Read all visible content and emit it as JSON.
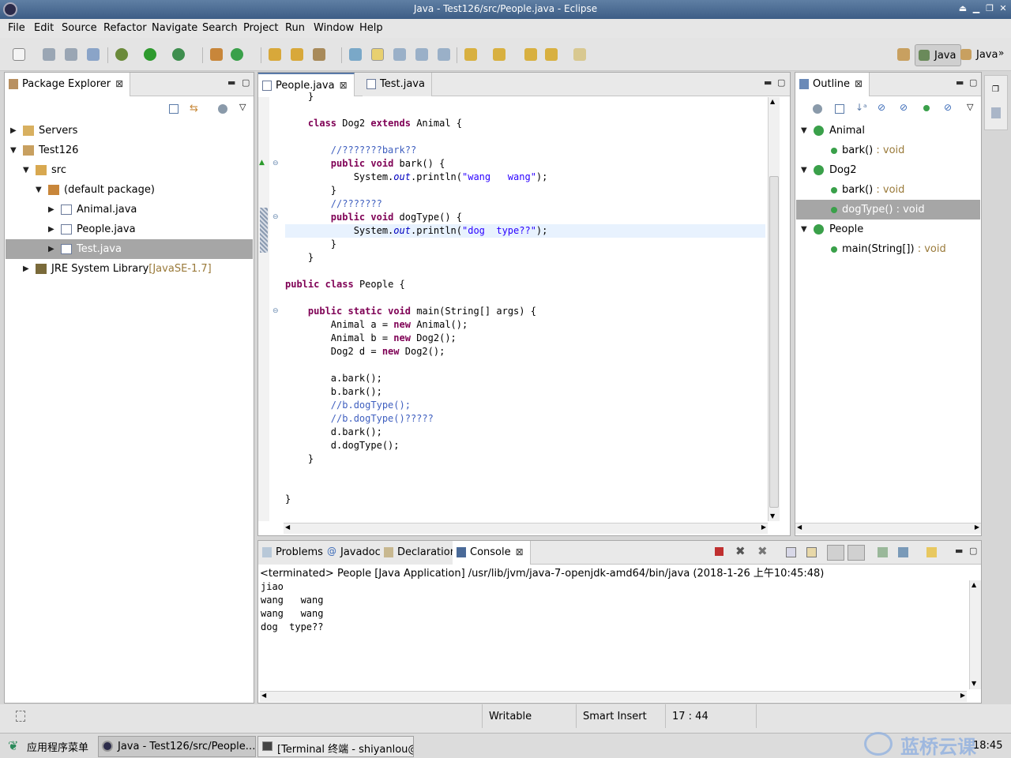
{
  "window": {
    "title": "Java - Test126/src/People.java - Eclipse"
  },
  "menubar": [
    "File",
    "Edit",
    "Source",
    "Refactor",
    "Navigate",
    "Search",
    "Project",
    "Run",
    "Window",
    "Help"
  ],
  "perspectives": [
    "Java",
    "Java"
  ],
  "package_explorer": {
    "title": "Package Explorer",
    "tree": [
      {
        "label": "Servers",
        "indent": 0,
        "expanded": false,
        "icon": "folder-icon"
      },
      {
        "label": "Test126",
        "indent": 0,
        "expanded": true,
        "icon": "project-icon"
      },
      {
        "label": "src",
        "indent": 1,
        "expanded": true,
        "icon": "source-folder-icon"
      },
      {
        "label": "(default package)",
        "indent": 2,
        "expanded": true,
        "icon": "package-icon"
      },
      {
        "label": "Animal.java",
        "indent": 3,
        "expanded": false,
        "icon": "java-file-icon"
      },
      {
        "label": "People.java",
        "indent": 3,
        "expanded": false,
        "icon": "java-file-icon"
      },
      {
        "label": "Test.java",
        "indent": 3,
        "expanded": false,
        "icon": "java-file-icon",
        "selected": true
      },
      {
        "label": "JRE System Library",
        "suffix": "[JavaSE-1.7]",
        "indent": 1,
        "expanded": false,
        "icon": "library-icon"
      }
    ]
  },
  "editor": {
    "tabs": [
      {
        "label": "People.java",
        "active": true
      },
      {
        "label": "Test.java",
        "active": false
      }
    ],
    "lines": [
      "    }",
      "",
      "    class Dog2 extends Animal {",
      "",
      "        //???????bark??",
      "        public void bark() {",
      "            System.out.println(\"wang   wang\");",
      "        }",
      "        //???????",
      "        public void dogType() {",
      "            System.out.println(\"dog  type??\");",
      "        }",
      "    }",
      "",
      "public class People {",
      "",
      "    public static void main(String[] args) {",
      "        Animal a = new Animal();",
      "        Animal b = new Dog2();",
      "        Dog2 d = new Dog2();",
      "",
      "        a.bark();",
      "        b.bark();",
      "        //b.dogType();",
      "        //b.dogType()?????",
      "        d.bark();",
      "        d.dogType();",
      "    }",
      "",
      "",
      "}"
    ],
    "current_line_index": 10
  },
  "outline": {
    "title": "Outline",
    "items": [
      {
        "label": "Animal",
        "type": "",
        "indent": 0,
        "kind": "class"
      },
      {
        "label": "bark()",
        "type": " : void",
        "indent": 1,
        "kind": "method"
      },
      {
        "label": "Dog2",
        "type": "",
        "indent": 0,
        "kind": "class"
      },
      {
        "label": "bark()",
        "type": " : void",
        "indent": 1,
        "kind": "method-override"
      },
      {
        "label": "dogType()",
        "type": " : void",
        "indent": 1,
        "kind": "method",
        "selected": true
      },
      {
        "label": "People",
        "type": "",
        "indent": 0,
        "kind": "class-main"
      },
      {
        "label": "main(String[])",
        "type": " : void",
        "indent": 1,
        "kind": "method-static"
      }
    ]
  },
  "bottom_panel": {
    "tabs": [
      "Problems",
      "Javadoc",
      "Declaration",
      "Console"
    ],
    "active_tab": "Console",
    "console_header": "<terminated> People [Java Application] /usr/lib/jvm/java-7-openjdk-amd64/bin/java (2018-1-26 上午10:45:48)",
    "output": [
      "jiao",
      "wang   wang",
      "wang   wang",
      "dog  type??"
    ]
  },
  "statusbar": {
    "writable": "Writable",
    "insert_mode": "Smart Insert",
    "position": "17 : 44"
  },
  "taskbar": {
    "start_menu": "应用程序菜单",
    "tasks": [
      {
        "label": "Java - Test126/src/People.…",
        "active": true
      },
      {
        "label": "[Terminal 终端 - shiyanlou@…",
        "active": false
      }
    ],
    "watermark": "蓝桥云课",
    "clock": "18:45"
  }
}
